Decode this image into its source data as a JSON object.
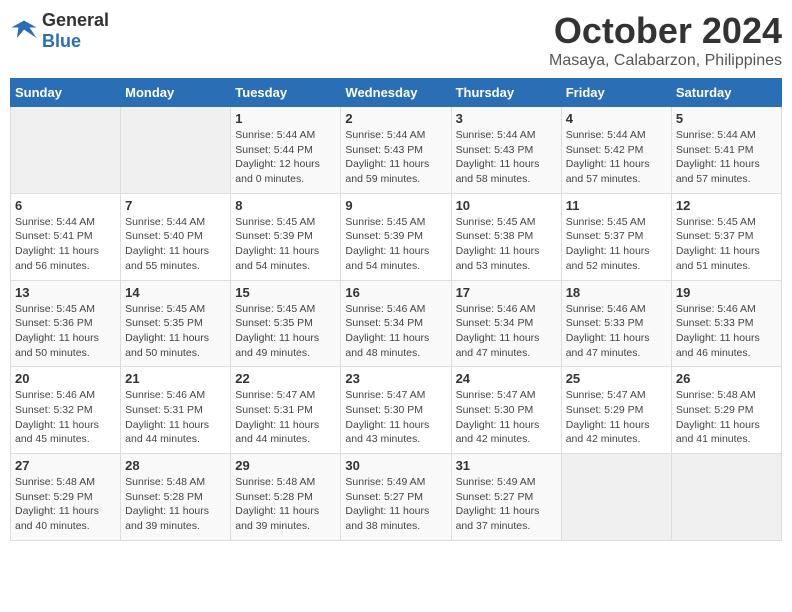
{
  "header": {
    "logo_general": "General",
    "logo_blue": "Blue",
    "month_title": "October 2024",
    "location": "Masaya, Calabarzon, Philippines"
  },
  "days_of_week": [
    "Sunday",
    "Monday",
    "Tuesday",
    "Wednesday",
    "Thursday",
    "Friday",
    "Saturday"
  ],
  "weeks": [
    [
      {
        "day": "",
        "info": ""
      },
      {
        "day": "",
        "info": ""
      },
      {
        "day": "1",
        "info": "Sunrise: 5:44 AM\nSunset: 5:44 PM\nDaylight: 12 hours and 0 minutes."
      },
      {
        "day": "2",
        "info": "Sunrise: 5:44 AM\nSunset: 5:43 PM\nDaylight: 11 hours and 59 minutes."
      },
      {
        "day": "3",
        "info": "Sunrise: 5:44 AM\nSunset: 5:43 PM\nDaylight: 11 hours and 58 minutes."
      },
      {
        "day": "4",
        "info": "Sunrise: 5:44 AM\nSunset: 5:42 PM\nDaylight: 11 hours and 57 minutes."
      },
      {
        "day": "5",
        "info": "Sunrise: 5:44 AM\nSunset: 5:41 PM\nDaylight: 11 hours and 57 minutes."
      }
    ],
    [
      {
        "day": "6",
        "info": "Sunrise: 5:44 AM\nSunset: 5:41 PM\nDaylight: 11 hours and 56 minutes."
      },
      {
        "day": "7",
        "info": "Sunrise: 5:44 AM\nSunset: 5:40 PM\nDaylight: 11 hours and 55 minutes."
      },
      {
        "day": "8",
        "info": "Sunrise: 5:45 AM\nSunset: 5:39 PM\nDaylight: 11 hours and 54 minutes."
      },
      {
        "day": "9",
        "info": "Sunrise: 5:45 AM\nSunset: 5:39 PM\nDaylight: 11 hours and 54 minutes."
      },
      {
        "day": "10",
        "info": "Sunrise: 5:45 AM\nSunset: 5:38 PM\nDaylight: 11 hours and 53 minutes."
      },
      {
        "day": "11",
        "info": "Sunrise: 5:45 AM\nSunset: 5:37 PM\nDaylight: 11 hours and 52 minutes."
      },
      {
        "day": "12",
        "info": "Sunrise: 5:45 AM\nSunset: 5:37 PM\nDaylight: 11 hours and 51 minutes."
      }
    ],
    [
      {
        "day": "13",
        "info": "Sunrise: 5:45 AM\nSunset: 5:36 PM\nDaylight: 11 hours and 50 minutes."
      },
      {
        "day": "14",
        "info": "Sunrise: 5:45 AM\nSunset: 5:35 PM\nDaylight: 11 hours and 50 minutes."
      },
      {
        "day": "15",
        "info": "Sunrise: 5:45 AM\nSunset: 5:35 PM\nDaylight: 11 hours and 49 minutes."
      },
      {
        "day": "16",
        "info": "Sunrise: 5:46 AM\nSunset: 5:34 PM\nDaylight: 11 hours and 48 minutes."
      },
      {
        "day": "17",
        "info": "Sunrise: 5:46 AM\nSunset: 5:34 PM\nDaylight: 11 hours and 47 minutes."
      },
      {
        "day": "18",
        "info": "Sunrise: 5:46 AM\nSunset: 5:33 PM\nDaylight: 11 hours and 47 minutes."
      },
      {
        "day": "19",
        "info": "Sunrise: 5:46 AM\nSunset: 5:33 PM\nDaylight: 11 hours and 46 minutes."
      }
    ],
    [
      {
        "day": "20",
        "info": "Sunrise: 5:46 AM\nSunset: 5:32 PM\nDaylight: 11 hours and 45 minutes."
      },
      {
        "day": "21",
        "info": "Sunrise: 5:46 AM\nSunset: 5:31 PM\nDaylight: 11 hours and 44 minutes."
      },
      {
        "day": "22",
        "info": "Sunrise: 5:47 AM\nSunset: 5:31 PM\nDaylight: 11 hours and 44 minutes."
      },
      {
        "day": "23",
        "info": "Sunrise: 5:47 AM\nSunset: 5:30 PM\nDaylight: 11 hours and 43 minutes."
      },
      {
        "day": "24",
        "info": "Sunrise: 5:47 AM\nSunset: 5:30 PM\nDaylight: 11 hours and 42 minutes."
      },
      {
        "day": "25",
        "info": "Sunrise: 5:47 AM\nSunset: 5:29 PM\nDaylight: 11 hours and 42 minutes."
      },
      {
        "day": "26",
        "info": "Sunrise: 5:48 AM\nSunset: 5:29 PM\nDaylight: 11 hours and 41 minutes."
      }
    ],
    [
      {
        "day": "27",
        "info": "Sunrise: 5:48 AM\nSunset: 5:29 PM\nDaylight: 11 hours and 40 minutes."
      },
      {
        "day": "28",
        "info": "Sunrise: 5:48 AM\nSunset: 5:28 PM\nDaylight: 11 hours and 39 minutes."
      },
      {
        "day": "29",
        "info": "Sunrise: 5:48 AM\nSunset: 5:28 PM\nDaylight: 11 hours and 39 minutes."
      },
      {
        "day": "30",
        "info": "Sunrise: 5:49 AM\nSunset: 5:27 PM\nDaylight: 11 hours and 38 minutes."
      },
      {
        "day": "31",
        "info": "Sunrise: 5:49 AM\nSunset: 5:27 PM\nDaylight: 11 hours and 37 minutes."
      },
      {
        "day": "",
        "info": ""
      },
      {
        "day": "",
        "info": ""
      }
    ]
  ]
}
